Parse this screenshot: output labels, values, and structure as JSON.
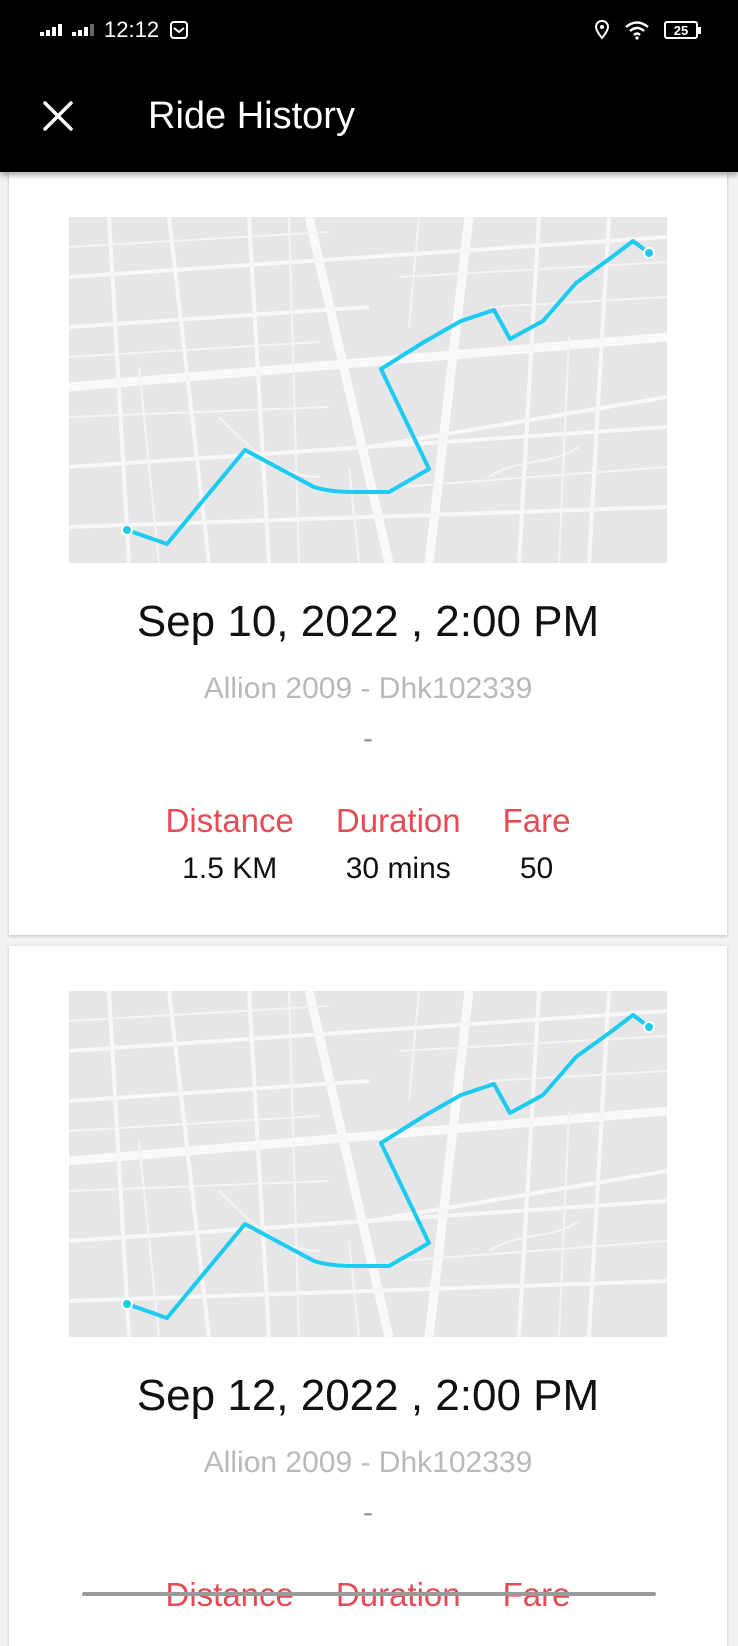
{
  "status_bar": {
    "time": "12:12",
    "battery": "25"
  },
  "app_bar": {
    "title": "Ride History"
  },
  "rides": [
    {
      "datetime": "Sep 10, 2022 , 2:00 PM",
      "vehicle": "Allion 2009 - Dhk102339",
      "note": "-",
      "distance_label": "Distance",
      "distance_value": "1.5 KM",
      "duration_label": "Duration",
      "duration_value": "30 mins",
      "fare_label": "Fare",
      "fare_value": "50"
    },
    {
      "datetime": "Sep 12, 2022 , 2:00 PM",
      "vehicle": "Allion 2009 - Dhk102339",
      "note": "-",
      "distance_label": "Distance",
      "distance_value": "",
      "duration_label": "Duration",
      "duration_value": "",
      "fare_label": "Fare",
      "fare_value": ""
    }
  ],
  "colors": {
    "accent": "#e44b55",
    "route": "#1ccbf0",
    "appbar": "#000000"
  },
  "icons": {
    "close": "close-icon",
    "location": "location-icon",
    "wifi": "wifi-icon",
    "mail": "mail-icon"
  }
}
